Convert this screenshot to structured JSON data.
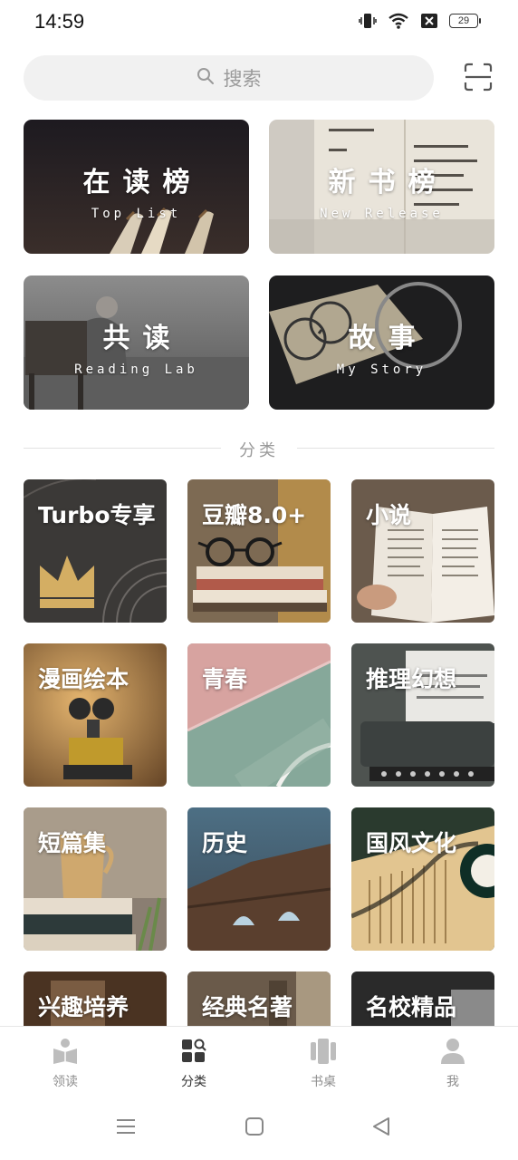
{
  "status_bar": {
    "time": "14:59",
    "battery": "29"
  },
  "search": {
    "placeholder": "搜索"
  },
  "banners": [
    {
      "title": "在读榜",
      "subtitle": "Top List"
    },
    {
      "title": "新书榜",
      "subtitle": "New Release"
    },
    {
      "title": "共读",
      "subtitle": "Reading Lab"
    },
    {
      "title": "故事",
      "subtitle": "My Story"
    }
  ],
  "section": {
    "label": "分类"
  },
  "categories": [
    "Turbo专享",
    "豆瓣8.0+",
    "小说",
    "漫画绘本",
    "青春",
    "推理幻想",
    "短篇集",
    "历史",
    "国风文化",
    "兴趣培养",
    "经典名著",
    "名校精品"
  ],
  "bottom_nav": [
    {
      "label": "领读",
      "icon": "book-open-icon",
      "active": false
    },
    {
      "label": "分类",
      "icon": "category-grid-icon",
      "active": true
    },
    {
      "label": "书桌",
      "icon": "bookshelf-icon",
      "active": false
    },
    {
      "label": "我",
      "icon": "person-icon",
      "active": false
    }
  ],
  "system_nav": [
    "menu-icon",
    "home-square-icon",
    "back-triangle-icon"
  ],
  "colors": {
    "search_bg": "#f1f1f1",
    "divider": "#e2e2e2",
    "muted_text": "#9a9a9a"
  }
}
